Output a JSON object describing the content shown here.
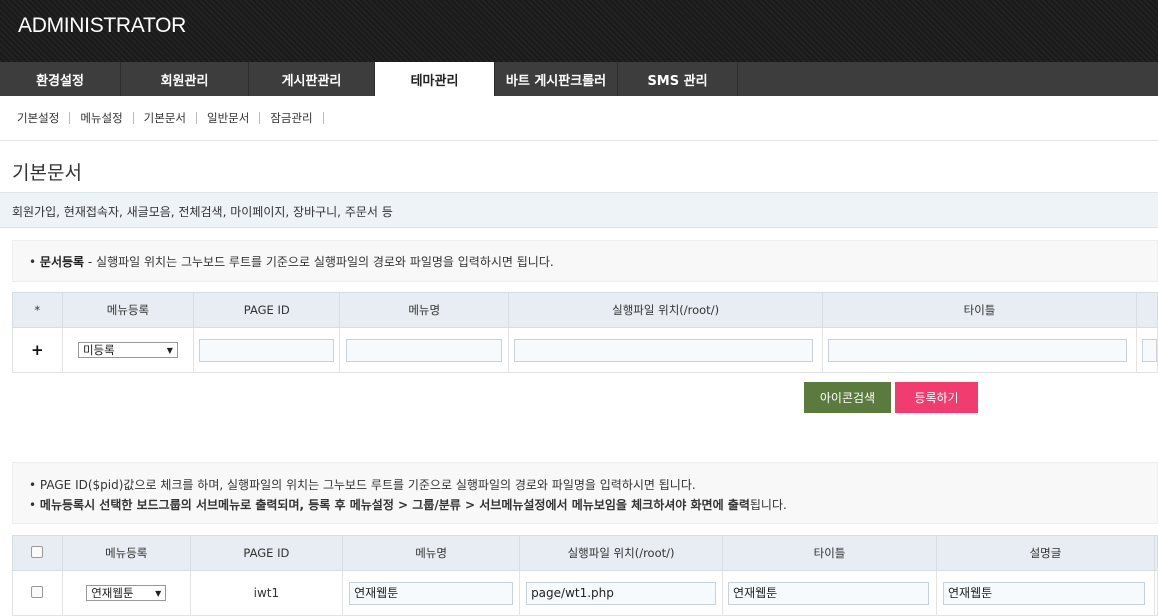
{
  "header": {
    "title": "ADMINISTRATOR"
  },
  "mainnav": {
    "tabs": [
      {
        "label": "환경설정"
      },
      {
        "label": "회원관리"
      },
      {
        "label": "게시판관리"
      },
      {
        "label": "테마관리"
      },
      {
        "label": "바트 게시판크롤러"
      },
      {
        "label": "SMS 관리"
      }
    ],
    "active": "테마관리"
  },
  "subnav": {
    "items": [
      {
        "label": "기본설정"
      },
      {
        "label": "메뉴설정"
      },
      {
        "label": "기본문서"
      },
      {
        "label": "일반문서"
      },
      {
        "label": "잠금관리"
      }
    ]
  },
  "page": {
    "title": "기본문서",
    "description": "회원가입, 현재접속자, 새글모음, 전체검색, 마이페이지, 장바구니, 주문서 등"
  },
  "notice1": {
    "bullet": "•",
    "strong": "문서등록",
    "text": " - 실행파일 위치는 그누보드 루트를 기준으로 실행파일의 경로와 파일명을 입력하시면 됩니다."
  },
  "register_table": {
    "headers": [
      "*",
      "메뉴등록",
      "PAGE ID",
      "메뉴명",
      "실행파일 위치(/root/)",
      "타이틀"
    ],
    "row": {
      "add_symbol": "+",
      "menu_select": "미등록",
      "select_arrow": "▼"
    }
  },
  "buttons": {
    "icon_search": "아이콘검색",
    "register": "등록하기"
  },
  "notice2": {
    "bullet": "•",
    "line1": "PAGE ID($pid)값으로 체크를 하며, 실행파일의 위치는 그누보드 루트를 기준으로 실행파일의 경로와 파일명을 입력하시면 됩니다.",
    "line2": "메뉴등록시 선택한 보드그룹의 서브메뉴로 출력되며, 등록 후 메뉴설정 > 그룹/분류 > 서브메뉴설정에서 메뉴보임을 체크하셔야 화면에 출력",
    "line2_tail": "됩니다."
  },
  "list_table": {
    "headers": [
      "메뉴등록",
      "PAGE ID",
      "메뉴명",
      "실행파일 위치(/root/)",
      "타이틀",
      "설명글"
    ],
    "rows": [
      {
        "menu_select": "연재웹툰",
        "select_arrow": "▼",
        "page_id": "iwt1",
        "menu_name": "연재웹툰",
        "file_path": "page/wt1.php",
        "title": "연재웹툰",
        "description": "연재웹툰"
      }
    ]
  },
  "colors": {
    "header_bg": "#1f1f1f",
    "nav_bg": "#3d3d3d",
    "th_bg": "#e7edf2",
    "btn_green": "#5b7a3d",
    "btn_pink": "#f03c6f"
  }
}
